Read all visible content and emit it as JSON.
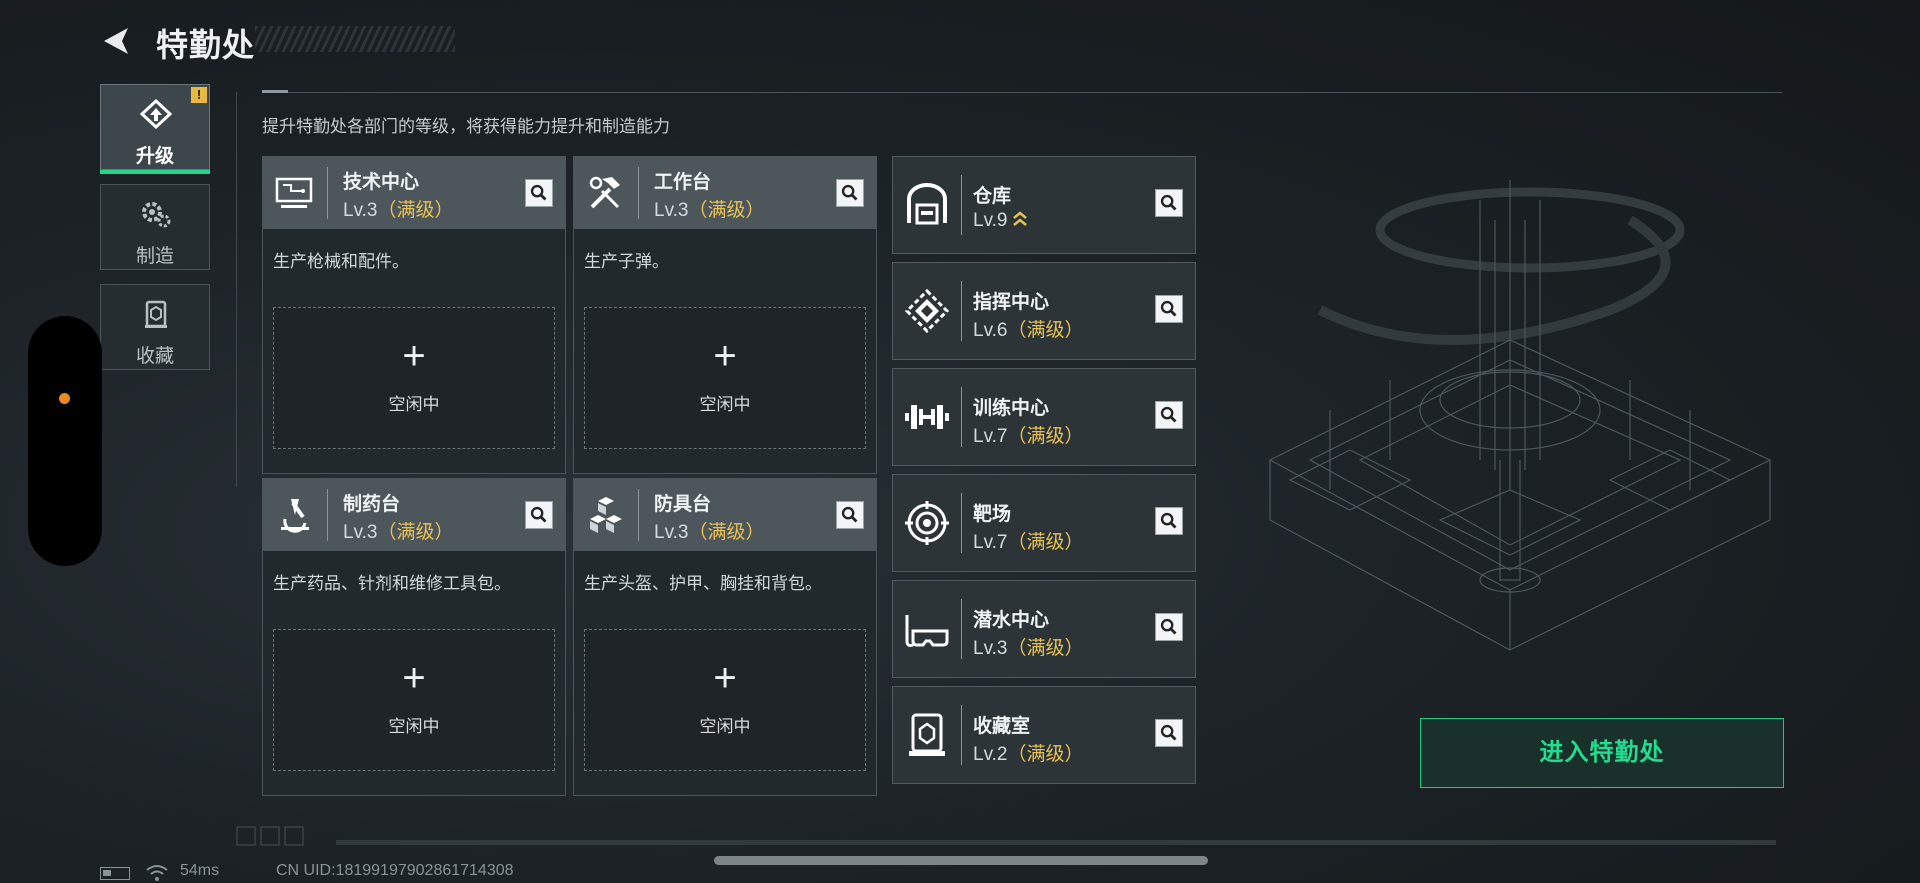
{
  "header": {
    "title": "特勤处"
  },
  "subtitle": "提升特勤处各部门的等级，将获得能力提升和制造能力",
  "tabs": [
    {
      "label": "升级",
      "icon": "upgrade-icon",
      "active": true,
      "alert": "!"
    },
    {
      "label": "制造",
      "icon": "gears-icon",
      "active": false
    },
    {
      "label": "收藏",
      "icon": "collection-icon",
      "active": false
    }
  ],
  "workstations": [
    {
      "name": "技术中心",
      "level": "Lv.3",
      "status": "（满级）",
      "desc": "生产枪械和配件。",
      "slot_label": "空闲中",
      "icon": "tech-center-icon"
    },
    {
      "name": "工作台",
      "level": "Lv.3",
      "status": "（满级）",
      "desc": "生产子弹。",
      "slot_label": "空闲中",
      "icon": "workbench-icon"
    },
    {
      "name": "制药台",
      "level": "Lv.3",
      "status": "（满级）",
      "desc": "生产药品、针剂和维修工具包。",
      "slot_label": "空闲中",
      "icon": "pharmacy-icon"
    },
    {
      "name": "防具台",
      "level": "Lv.3",
      "status": "（满级）",
      "desc": "生产头盔、护甲、胸挂和背包。",
      "slot_label": "空闲中",
      "icon": "armor-bench-icon"
    }
  ],
  "facilities": [
    {
      "name": "仓库",
      "level": "Lv.9",
      "status": "",
      "upgradable": true,
      "icon": "warehouse-icon"
    },
    {
      "name": "指挥中心",
      "level": "Lv.6",
      "status": "（满级）",
      "icon": "command-center-icon"
    },
    {
      "name": "训练中心",
      "level": "Lv.7",
      "status": "（满级）",
      "icon": "training-center-icon"
    },
    {
      "name": "靶场",
      "level": "Lv.7",
      "status": "（满级）",
      "icon": "shooting-range-icon"
    },
    {
      "name": "潜水中心",
      "level": "Lv.3",
      "status": "（满级）",
      "icon": "diving-center-icon"
    },
    {
      "name": "收藏室",
      "level": "Lv.2",
      "status": "（满级）",
      "icon": "collection-room-icon"
    }
  ],
  "enter_button": "进入特勤处",
  "status_bar": {
    "ping": "54ms",
    "uid": "CN UID:18199197902861714308"
  },
  "colors": {
    "accent": "#22d48c",
    "gold": "#e8c154",
    "alert": "#e9b93b",
    "pill_dot": "#f08a1c"
  }
}
